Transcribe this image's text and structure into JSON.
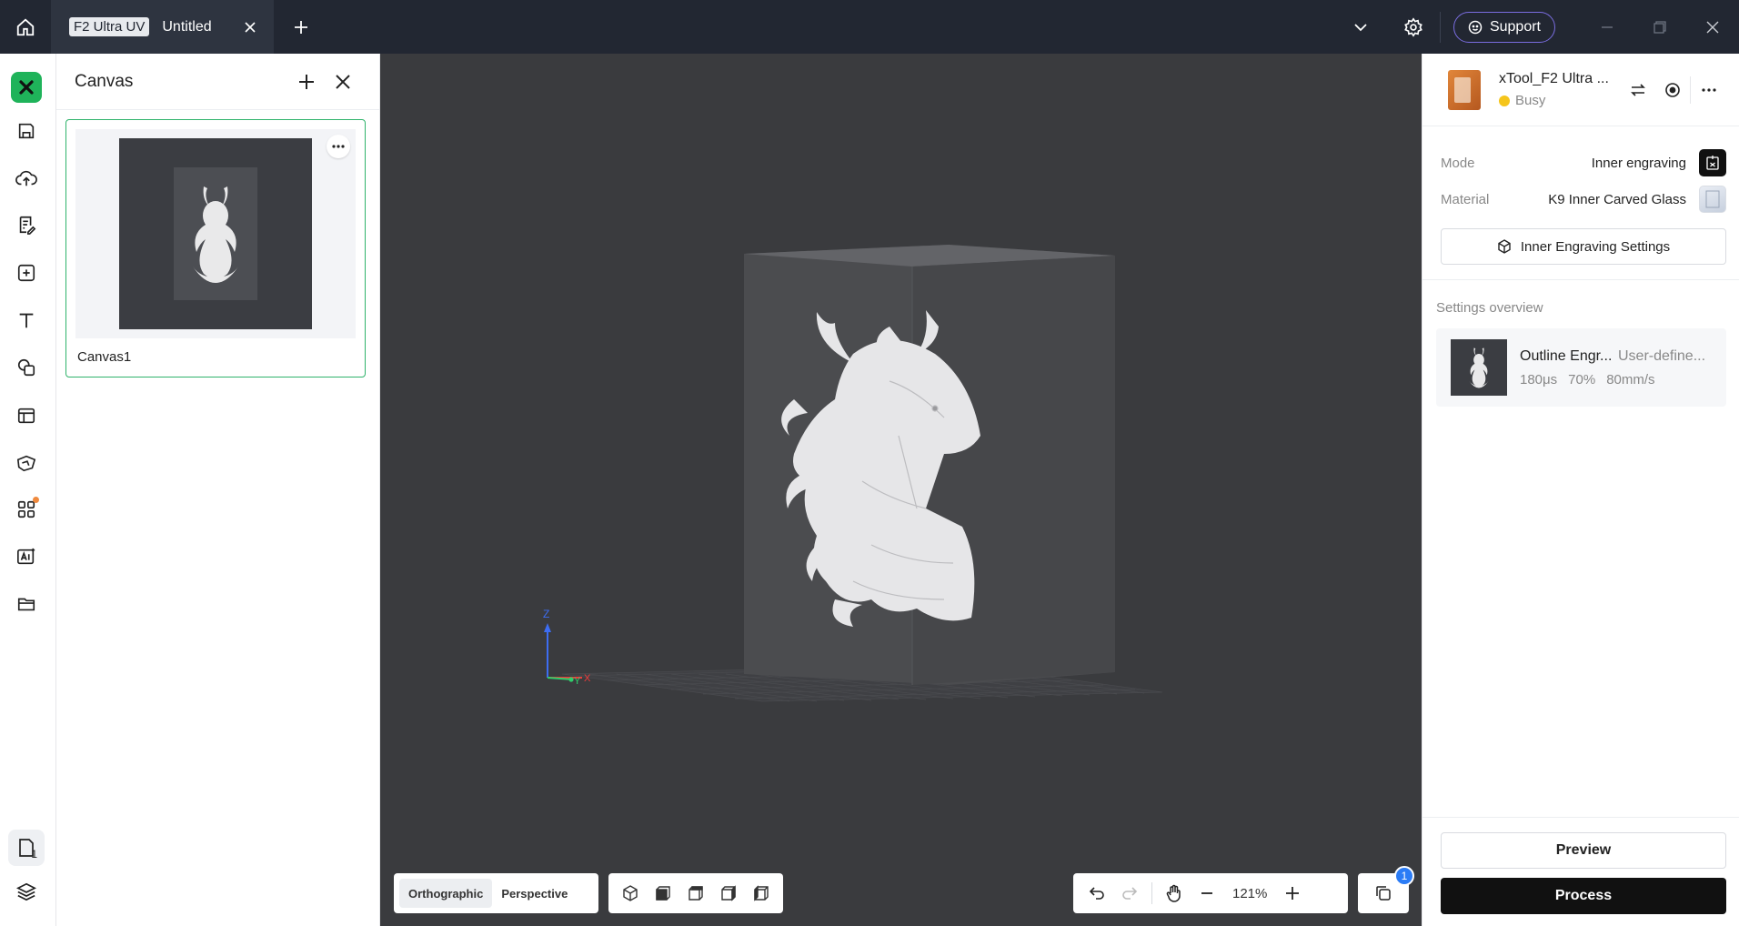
{
  "titlebar": {
    "tab_badge": "F2 Ultra UV",
    "tab_title": "Untitled",
    "support_label": "Support"
  },
  "rail": {
    "page_count": "1"
  },
  "canvas_panel": {
    "title": "Canvas",
    "canvases": [
      {
        "name": "Canvas1"
      }
    ]
  },
  "viewport": {
    "axis_z": "Z",
    "axis_y": "Y",
    "axis_x": "X",
    "view_modes": [
      "Orthographic",
      "Perspective"
    ],
    "active_view_mode": "Orthographic",
    "zoom": "121%",
    "layer_count": "1"
  },
  "device": {
    "name": "xTool_F2 Ultra ...",
    "status": "Busy",
    "status_color": "#f5c51b"
  },
  "settings": {
    "mode_label": "Mode",
    "mode_value": "Inner engraving",
    "material_label": "Material",
    "material_value": "K9 Inner Carved Glass",
    "inner_engraving_button": "Inner Engraving Settings"
  },
  "overview": {
    "title": "Settings overview",
    "items": [
      {
        "name": "Outline Engr...",
        "preset": "User-define...",
        "time": "180μs",
        "power": "70%",
        "speed": "80mm/s"
      }
    ]
  },
  "footer": {
    "preview_label": "Preview",
    "process_label": "Process"
  },
  "colors": {
    "accent_green": "#1fb35a",
    "titlebar_bg": "#222732",
    "viewport_bg": "#3a3b3e",
    "badge_blue": "#2b7cf6"
  }
}
